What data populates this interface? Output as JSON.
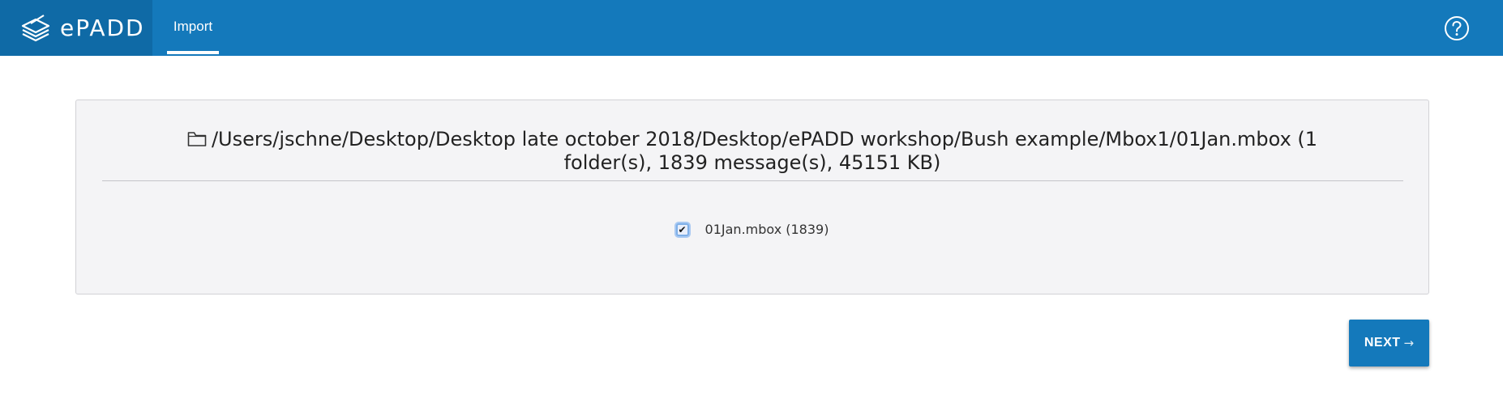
{
  "header": {
    "brand": "ePADD",
    "tabs": [
      {
        "label": "Import",
        "active": true
      }
    ],
    "help_icon": "help-circle-icon",
    "colors": {
      "header_bg": "#1479bb",
      "brand_bg": "#0f6aa6"
    }
  },
  "panel": {
    "folder_icon": "folder-icon",
    "title": "/Users/jschne/Desktop/Desktop late october 2018/Desktop/ePADD workshop/Bush example/Mbox1/01Jan.mbox (1 folder(s), 1839 message(s), 45151 KB)",
    "folders": [
      {
        "label": "01Jan.mbox (1839)",
        "checked": true
      }
    ]
  },
  "actions": {
    "next_label": "NEXT",
    "next_icon": "arrow-right-icon",
    "next_arrow": "→"
  }
}
